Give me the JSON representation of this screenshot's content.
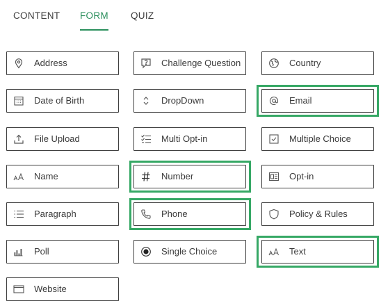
{
  "tabs": [
    {
      "label": "CONTENT"
    },
    {
      "label": "FORM",
      "active": true
    },
    {
      "label": "QUIZ"
    }
  ],
  "accent_color": "#2a8f5c",
  "highlight_color": "#36a865",
  "fields": [
    {
      "label": "Address",
      "icon": "location-pin-icon"
    },
    {
      "label": "Challenge Question",
      "icon": "question-bubble-icon"
    },
    {
      "label": "Country",
      "icon": "globe-icon"
    },
    {
      "label": "Date of Birth",
      "icon": "calendar-icon"
    },
    {
      "label": "DropDown",
      "icon": "chevron-updown-icon"
    },
    {
      "label": "Email",
      "icon": "at-sign-icon",
      "highlighted": true
    },
    {
      "label": "File Upload",
      "icon": "upload-icon"
    },
    {
      "label": "Multi Opt-in",
      "icon": "checklist-icon"
    },
    {
      "label": "Multiple Choice",
      "icon": "checkbox-icon"
    },
    {
      "label": "Name",
      "icon": "text-size-icon"
    },
    {
      "label": "Number",
      "icon": "hash-icon",
      "highlighted": true
    },
    {
      "label": "Opt-in",
      "icon": "optin-card-icon"
    },
    {
      "label": "Paragraph",
      "icon": "list-lines-icon"
    },
    {
      "label": "Phone",
      "icon": "phone-icon",
      "highlighted": true
    },
    {
      "label": "Policy & Rules",
      "icon": "shield-icon"
    },
    {
      "label": "Poll",
      "icon": "bar-chart-icon"
    },
    {
      "label": "Single Choice",
      "icon": "radio-button-icon"
    },
    {
      "label": "Text",
      "icon": "text-size-icon",
      "highlighted": true
    },
    {
      "label": "Website",
      "icon": "browser-window-icon"
    }
  ]
}
